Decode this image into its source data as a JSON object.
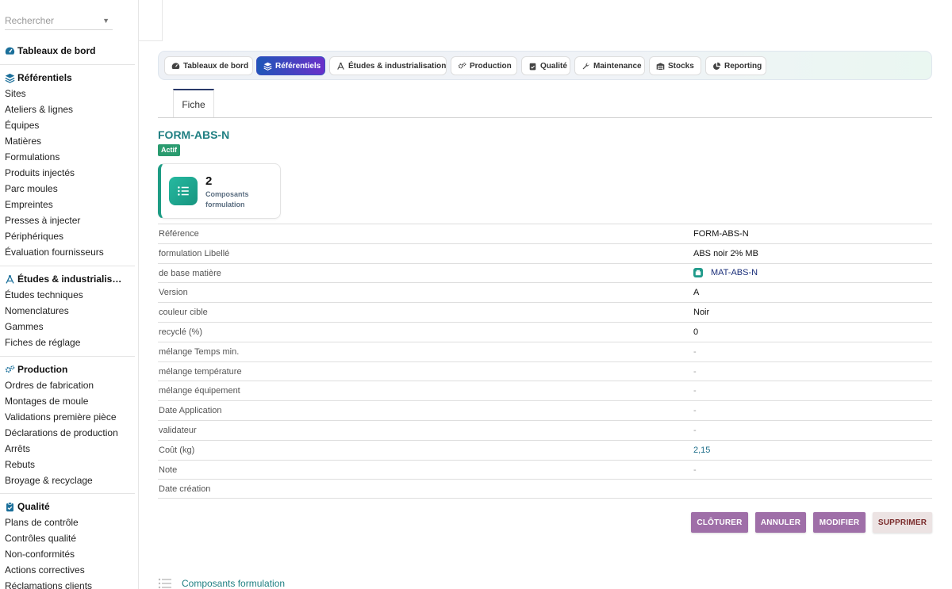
{
  "search": {
    "placeholder": "Rechercher"
  },
  "sidebar": {
    "sections": [
      {
        "title": "Tableaux de bord",
        "icon": "gauge-icon",
        "items": []
      },
      {
        "title": "Référentiels",
        "icon": "layers-icon",
        "items": [
          "Sites",
          "Ateliers & lignes",
          "Équipes",
          "Matières",
          "Formulations",
          "Produits injectés",
          "Parc moules",
          "Empreintes",
          "Presses à injecter",
          "Périphériques",
          "Évaluation fournisseurs"
        ]
      },
      {
        "title": "Études & industrialis…",
        "icon": "compass-icon",
        "items": [
          "Études techniques",
          "Nomenclatures",
          "Gammes",
          "Fiches de réglage"
        ]
      },
      {
        "title": "Production",
        "icon": "gears-icon",
        "items": [
          "Ordres de fabrication",
          "Montages de moule",
          "Validations première pièce",
          "Déclarations de production",
          "Arrêts",
          "Rebuts",
          "Broyage & recyclage"
        ]
      },
      {
        "title": "Qualité",
        "icon": "clipboard-check-icon",
        "items": [
          "Plans de contrôle",
          "Contrôles qualité",
          "Non-conformités",
          "Actions correctives",
          "Réclamations clients"
        ]
      }
    ]
  },
  "topnav": {
    "tabs": [
      {
        "label": "Tableaux de bord",
        "icon": "gauge-icon",
        "active": false
      },
      {
        "label": "Référentiels",
        "icon": "layers-icon",
        "active": true
      },
      {
        "label": "Études & industrialisation",
        "icon": "compass-icon",
        "active": false
      },
      {
        "label": "Production",
        "icon": "gears-icon",
        "active": false
      },
      {
        "label": "Qualité",
        "icon": "clipboard-check-icon",
        "active": false
      },
      {
        "label": "Maintenance",
        "icon": "wrench-icon",
        "active": false
      },
      {
        "label": "Stocks",
        "icon": "warehouse-icon",
        "active": false
      },
      {
        "label": "Reporting",
        "icon": "pie-chart-icon",
        "active": false
      }
    ]
  },
  "record": {
    "tab_label": "Fiche",
    "title": "FORM-ABS-N",
    "status": "Actif",
    "stat": {
      "value": "2",
      "label": "Composants formulation"
    },
    "fields": [
      {
        "label": "Référence",
        "value": "FORM-ABS-N",
        "style": "normal"
      },
      {
        "label": "formulation Libellé",
        "value": "ABS noir 2% MB",
        "style": "normal"
      },
      {
        "label": "de base matière",
        "value": "MAT-ABS-N",
        "style": "link"
      },
      {
        "label": "Version",
        "value": "A",
        "style": "normal"
      },
      {
        "label": "couleur cible",
        "value": "Noir",
        "style": "normal"
      },
      {
        "label": "recyclé (%)",
        "value": "0",
        "style": "normal"
      },
      {
        "label": "mélange Temps min.",
        "value": "-",
        "style": "muted"
      },
      {
        "label": "mélange température",
        "value": "-",
        "style": "muted"
      },
      {
        "label": "mélange équipement",
        "value": "-",
        "style": "muted"
      },
      {
        "label": "Date Application",
        "value": "-",
        "style": "muted"
      },
      {
        "label": "validateur",
        "value": "-",
        "style": "muted"
      },
      {
        "label": "Coût (kg)",
        "value": "2,15",
        "style": "teal"
      },
      {
        "label": "Note",
        "value": "-",
        "style": "muted"
      },
      {
        "label": "Date création",
        "value": "",
        "style": "muted"
      }
    ]
  },
  "actions": {
    "close_label": "CLÔTURER",
    "cancel_label": "ANNULER",
    "edit_label": "MODIFIER",
    "delete_label": "SUPPRIMER"
  },
  "bottom_section": {
    "title": "Composants formulation",
    "icon": "list-icon"
  },
  "colors": {
    "accent_teal": "#1f7f82",
    "active_tab_start": "#1f56b8",
    "active_tab_end": "#6a2fc9",
    "status_green": "#2a9b6f",
    "action_purple": "#9f6fa8"
  }
}
